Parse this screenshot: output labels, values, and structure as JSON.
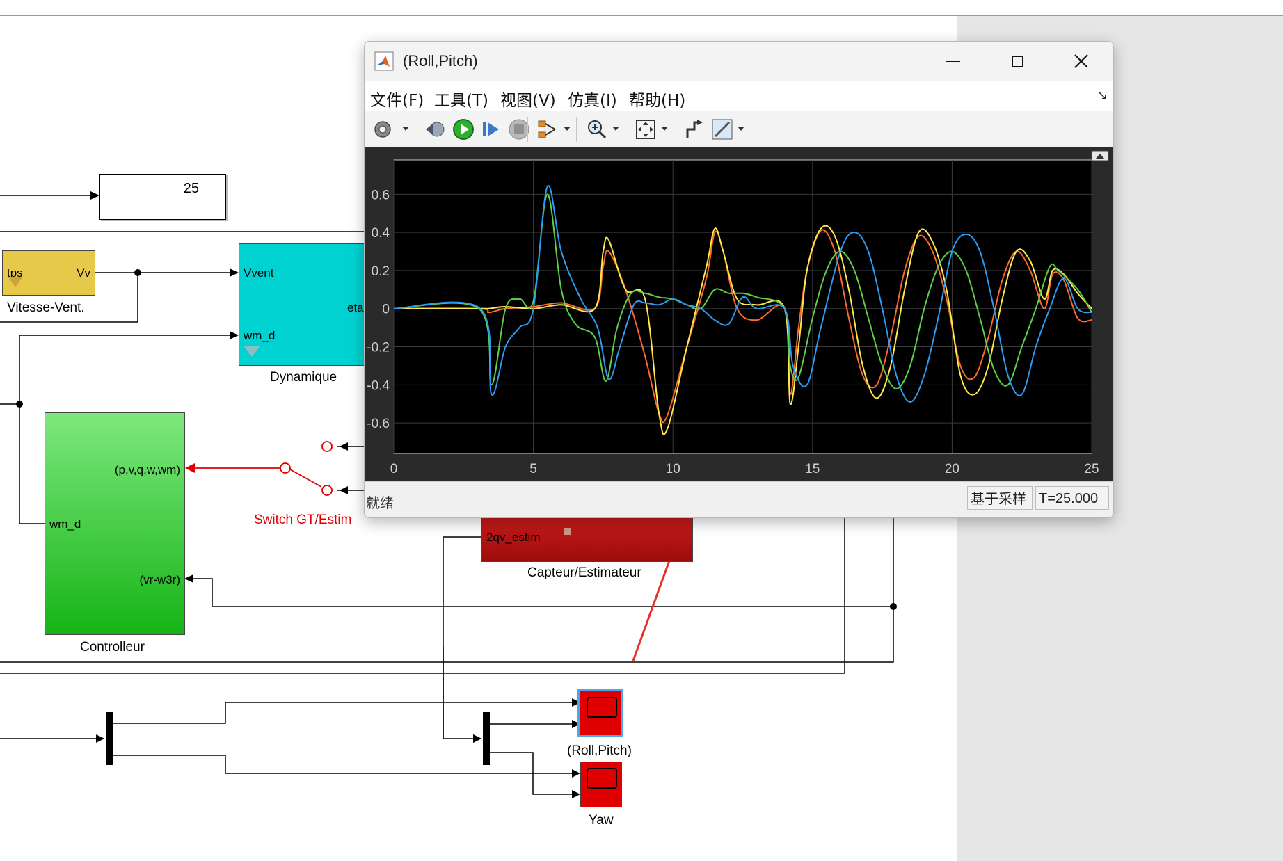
{
  "diagram": {
    "display_value": "25",
    "blocks": {
      "vitesse_vent": {
        "port_in": "tps",
        "port_out": "Vv",
        "label": "Vitesse-Vent."
      },
      "dynamique": {
        "port_in1": "Vvent",
        "port_in2": "wm_d",
        "port_out": "eta",
        "label": "Dynamique"
      },
      "controlleur": {
        "port_in1": "(p,v,q,w,wm)",
        "port_in2": "wm_d",
        "port_in3": "(vr-w3r)",
        "label": "Controlleur"
      },
      "switch": {
        "label": "Switch GT/Estim"
      },
      "capteur": {
        "port_in": "2qv_estim",
        "label": "Capteur/Estimateur"
      },
      "scope_roll_pitch": {
        "label": "(Roll,Pitch)"
      },
      "scope_yaw": {
        "label": "Yaw"
      }
    }
  },
  "scope_window": {
    "title": "(Roll,Pitch)",
    "menu": [
      "文件(F)",
      "工具(T)",
      "视图(V)",
      "仿真(I)",
      "帮助(H)"
    ],
    "toolbar_icons": [
      "settings-icon",
      "step-back-icon",
      "run-icon",
      "step-forward-icon",
      "stop-icon",
      "signal-select-icon",
      "zoom-icon",
      "autoscale-icon",
      "restore-icon",
      "measure-icon"
    ],
    "status": "就绪",
    "sample_mode": "基于采样",
    "time": "T=25.000"
  },
  "chart_data": {
    "type": "line",
    "xlim": [
      0,
      25
    ],
    "ylim": [
      -0.76,
      0.78
    ],
    "xticks": [
      "0",
      "5",
      "10",
      "15",
      "20",
      "25"
    ],
    "yticks": [
      "0.6",
      "0.4",
      "0.2",
      "0",
      "-0.2",
      "-0.4",
      "-0.6"
    ],
    "grid": true,
    "background": "#000000",
    "series": [
      {
        "color": "#ff6a30",
        "x": [
          0,
          3.05,
          3.4,
          4,
          5,
          6,
          7.2,
          7.5,
          7.7,
          8.3,
          9,
          9.5,
          9.8,
          10.5,
          11.2,
          11.5,
          11.8,
          12.3,
          13,
          14,
          14.2,
          14.5,
          14.8,
          15.3,
          15.8,
          16.3,
          16.8,
          17.3,
          17.8,
          18.3,
          18.8,
          19.3,
          19.8,
          20.3,
          20.8,
          21.3,
          21.8,
          22.3,
          22.8,
          23.3,
          23.6,
          24,
          24.5,
          25
        ],
        "y": [
          0,
          0,
          -0.02,
          0.0,
          0.01,
          0.03,
          0.0,
          0.22,
          0.3,
          0.1,
          -0.25,
          -0.55,
          -0.56,
          -0.2,
          0.16,
          0.4,
          0.3,
          0.0,
          -0.06,
          0.0,
          -0.45,
          -0.1,
          0.2,
          0.41,
          0.3,
          -0.05,
          -0.35,
          -0.4,
          -0.15,
          0.2,
          0.38,
          0.3,
          0.05,
          -0.3,
          -0.36,
          -0.15,
          0.15,
          0.3,
          0.2,
          0.0,
          0.18,
          0.15,
          -0.05,
          -0.06
        ]
      },
      {
        "color": "#ffe94a",
        "x": [
          0,
          3.05,
          3.4,
          4,
          5,
          6,
          7.2,
          7.5,
          7.7,
          8.3,
          9,
          9.5,
          9.8,
          10.5,
          11.2,
          11.5,
          11.8,
          12.3,
          13,
          14,
          14.2,
          14.5,
          14.8,
          15.3,
          15.8,
          16.3,
          16.8,
          17.3,
          17.8,
          18.3,
          18.8,
          19.3,
          19.8,
          20.3,
          20.8,
          21.3,
          21.8,
          22.3,
          22.8,
          23.3,
          23.6,
          24,
          24.5,
          25
        ],
        "y": [
          0,
          0,
          0.0,
          0.01,
          0.0,
          0.02,
          0.0,
          0.3,
          0.36,
          0.1,
          0.05,
          -0.55,
          -0.63,
          -0.2,
          0.22,
          0.42,
          0.3,
          0.05,
          0.02,
          0.0,
          -0.5,
          -0.2,
          0.2,
          0.42,
          0.38,
          0.1,
          -0.3,
          -0.47,
          -0.3,
          0.1,
          0.4,
          0.35,
          0.1,
          -0.35,
          -0.45,
          -0.3,
          0.05,
          0.3,
          0.25,
          0.05,
          0.2,
          0.18,
          0.08,
          0.0
        ]
      },
      {
        "color": "#5ecf4a",
        "x": [
          0,
          3.05,
          3.5,
          4,
          4.5,
          5,
          5.5,
          6,
          6.5,
          7.2,
          7.6,
          8,
          8.5,
          9,
          9.5,
          10,
          10.5,
          11,
          11.5,
          12,
          12.5,
          13,
          14,
          14.2,
          14.5,
          15,
          15.5,
          16,
          16.5,
          17,
          17.5,
          18,
          18.5,
          19,
          19.5,
          20,
          20.5,
          21,
          21.5,
          22,
          22.5,
          23,
          23.5,
          23.8,
          24.5,
          25
        ],
        "y": [
          0,
          0,
          -0.4,
          0.0,
          0.05,
          0.04,
          0.6,
          0.1,
          -0.08,
          -0.15,
          -0.38,
          -0.1,
          0.08,
          0.08,
          0.06,
          0.05,
          0.02,
          0.0,
          0.1,
          0.08,
          0.08,
          0.06,
          0.0,
          -0.3,
          -0.36,
          -0.05,
          0.2,
          0.3,
          0.2,
          -0.05,
          -0.3,
          -0.42,
          -0.3,
          0.0,
          0.22,
          0.3,
          0.2,
          -0.05,
          -0.32,
          -0.4,
          -0.2,
          0.0,
          0.22,
          0.2,
          0.1,
          -0.02
        ]
      },
      {
        "color": "#2b9bf4",
        "x": [
          0,
          3.1,
          3.5,
          4,
          4.5,
          5,
          5.5,
          6,
          6.7,
          7.3,
          7.7,
          8.1,
          8.6,
          9,
          9.5,
          10,
          10.5,
          11,
          11.5,
          12,
          12.5,
          13,
          14,
          14.3,
          14.8,
          15.3,
          16,
          16.5,
          17,
          17.5,
          18,
          18.5,
          19,
          19.5,
          20,
          20.5,
          21,
          21.5,
          22,
          22.5,
          23,
          23.5,
          24,
          24.5,
          25
        ],
        "y": [
          0,
          0,
          -0.45,
          -0.2,
          -0.1,
          0.0,
          0.64,
          0.3,
          0.05,
          -0.1,
          -0.37,
          -0.2,
          0.02,
          0.03,
          0.02,
          0.05,
          0.02,
          0.0,
          -0.06,
          -0.08,
          0.06,
          0.0,
          0.0,
          -0.3,
          -0.4,
          -0.1,
          0.3,
          0.4,
          0.3,
          0.0,
          -0.35,
          -0.49,
          -0.35,
          -0.05,
          0.3,
          0.39,
          0.3,
          0.0,
          -0.35,
          -0.45,
          -0.2,
          0.0,
          0.16,
          0.0,
          -0.02
        ]
      }
    ]
  }
}
